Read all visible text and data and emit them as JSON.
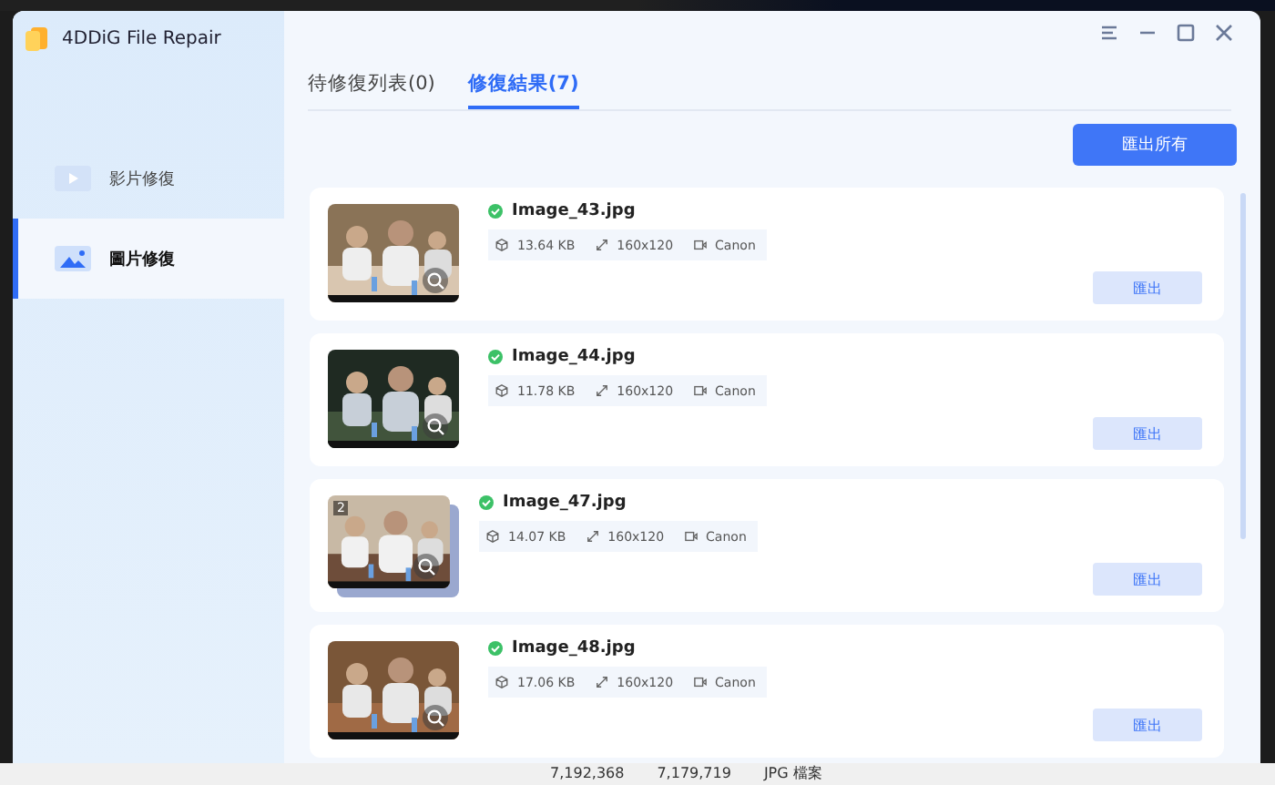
{
  "window": {
    "title": "4DDiG File Repair"
  },
  "sidebar": {
    "items": [
      {
        "label": "影片修復",
        "kind": "video",
        "selected": false
      },
      {
        "label": "圖片修復",
        "selected": true
      }
    ]
  },
  "tabs": [
    {
      "label": "待修復列表(0)",
      "selected": false
    },
    {
      "label": "修復結果(7)",
      "selected": true
    }
  ],
  "export_all_button": "匯出所有",
  "results": [
    {
      "name": "Image_43.jpg",
      "size": "13.64 KB",
      "dimensions": "160x120",
      "camera": "Canon",
      "export": "匯出"
    },
    {
      "name": "Image_44.jpg",
      "size": "11.78 KB",
      "dimensions": "160x120",
      "camera": "Canon",
      "export": "匯出"
    },
    {
      "name": "Image_47.jpg",
      "size": "14.07 KB",
      "dimensions": "160x120",
      "camera": "Canon",
      "export": "匯出",
      "count": "2"
    },
    {
      "name": "Image_48.jpg",
      "size": "17.06 KB",
      "dimensions": "160x120",
      "camera": "Canon",
      "export": "匯出"
    }
  ],
  "background_window": {
    "cells": [
      "7,192,368",
      "7,179,719",
      "JPG 檔案"
    ]
  }
}
